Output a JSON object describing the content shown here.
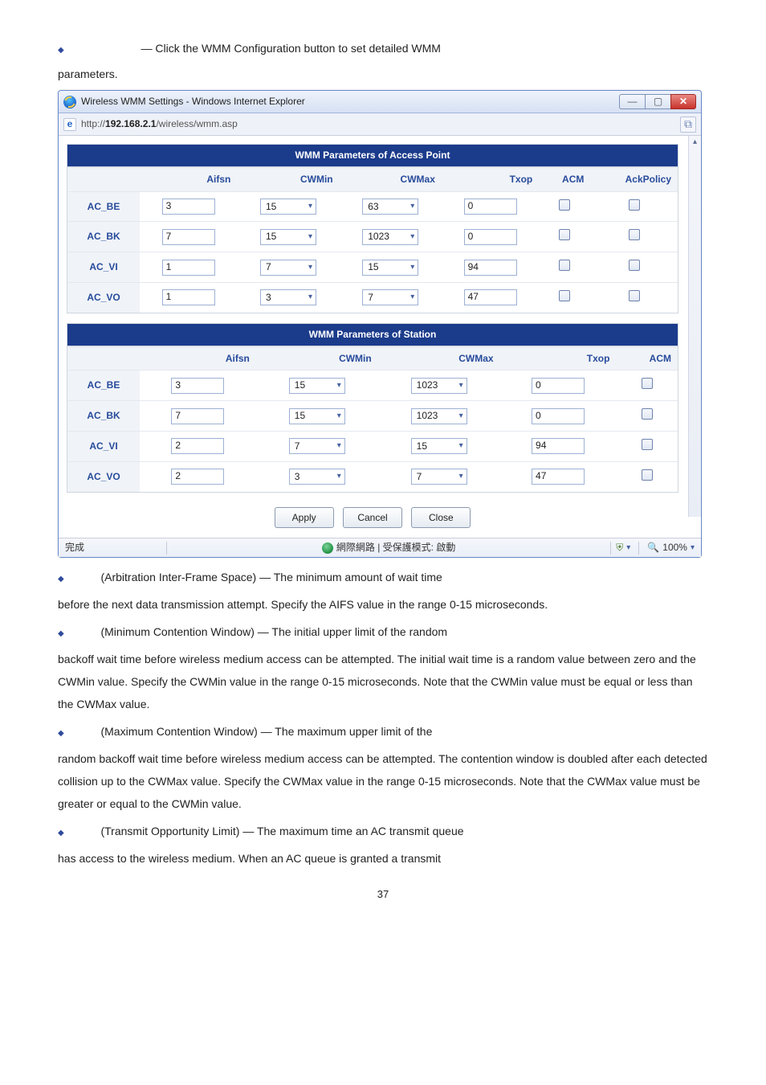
{
  "intro": {
    "line1": "— Click the WMM Configuration button to set detailed WMM",
    "line2": "parameters."
  },
  "window": {
    "title": "Wireless WMM Settings - Windows Internet Explorer",
    "url_prefix": "http://",
    "url_host": "192.168.2.1",
    "url_path": "/wireless/wmm.asp"
  },
  "table_ap": {
    "caption": "WMM Parameters of Access Point",
    "headers": [
      "Aifsn",
      "CWMin",
      "CWMax",
      "Txop",
      "ACM",
      "AckPolicy"
    ],
    "rows_hdr": [
      "AC_BE",
      "AC_BK",
      "AC_VI",
      "AC_VO"
    ],
    "aifsn": [
      "3",
      "7",
      "1",
      "1"
    ],
    "cwmin": [
      "15",
      "15",
      "7",
      "3"
    ],
    "cwmax": [
      "63",
      "1023",
      "15",
      "7"
    ],
    "txop": [
      "0",
      "0",
      "94",
      "47"
    ]
  },
  "table_sta": {
    "caption": "WMM Parameters of Station",
    "headers": [
      "Aifsn",
      "CWMin",
      "CWMax",
      "Txop",
      "ACM"
    ],
    "rows_hdr": [
      "AC_BE",
      "AC_BK",
      "AC_VI",
      "AC_VO"
    ],
    "aifsn": [
      "3",
      "7",
      "2",
      "2"
    ],
    "cwmin": [
      "15",
      "15",
      "7",
      "3"
    ],
    "cwmax": [
      "1023",
      "1023",
      "15",
      "7"
    ],
    "txop": [
      "0",
      "0",
      "94",
      "47"
    ]
  },
  "buttons": {
    "apply": "Apply",
    "cancel": "Cancel",
    "close": "Close"
  },
  "statusbar": {
    "left": "完成",
    "center": "網際網路 | 受保護模式: 啟動",
    "zoom": "100%"
  },
  "paras": {
    "p1a": "(Arbitration Inter-Frame Space) — The minimum amount of wait time",
    "p1b": "before the next data transmission attempt. Specify the AIFS value in the range 0-15 microseconds.",
    "p2a": "(Minimum Contention Window) — The initial upper limit of the random",
    "p2b": "backoff wait time before wireless medium access can be attempted. The initial wait time is a random value between zero and the CWMin value. Specify the CWMin value in the range 0-15 microseconds. Note that the CWMin value must be equal or less than the CWMax value.",
    "p3a": "(Maximum Contention Window) — The maximum upper limit of the",
    "p3b": "random backoff wait time before wireless medium access can be attempted. The contention window is doubled after each detected collision up to the CWMax value. Specify the CWMax value in the range 0-15 microseconds. Note that the CWMax value must be greater or equal to the CWMin value.",
    "p4a": "(Transmit Opportunity Limit) — The maximum time an AC transmit queue",
    "p4b": "has access to the wireless medium. When an AC queue is granted a transmit"
  },
  "page_number": "37"
}
